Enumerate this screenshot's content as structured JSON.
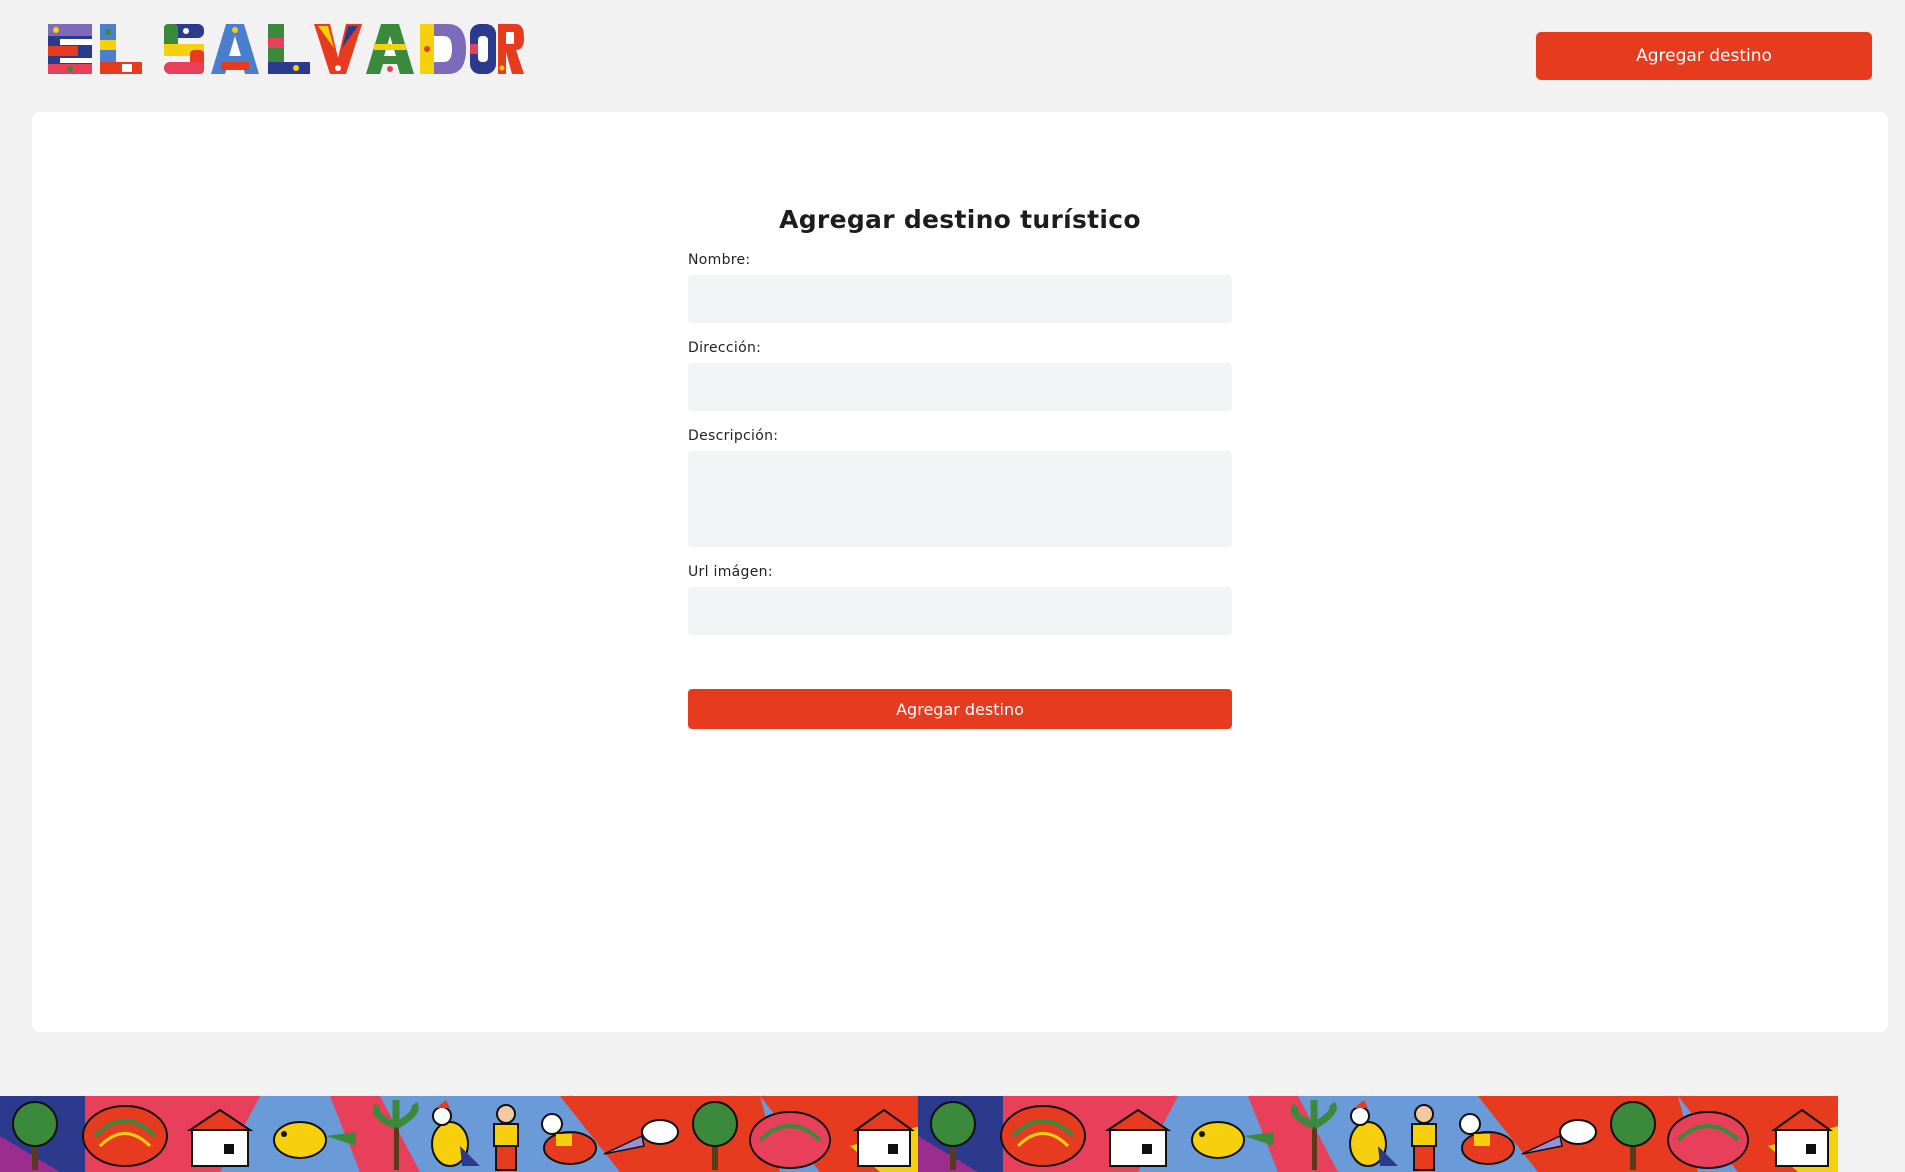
{
  "header": {
    "logo_text": "EL SALVADOR",
    "add_button_label": "Agregar destino"
  },
  "form": {
    "title": "Agregar destino turístico",
    "fields": [
      {
        "label": "Nombre:",
        "value": "",
        "placeholder": ""
      },
      {
        "label": "Dirección:",
        "value": "",
        "placeholder": ""
      },
      {
        "label": "Descripción:",
        "value": "",
        "placeholder": ""
      },
      {
        "label": "Url imágen:",
        "value": "",
        "placeholder": ""
      }
    ],
    "submit_label": "Agregar destino"
  },
  "theme": {
    "accent": "#e63b1f",
    "page_background": "#f2f2f2",
    "card_background": "#ffffff",
    "input_background": "#f2f3f4"
  },
  "footer": {
    "decoration_icons": [
      "tree-icon",
      "armadillo-icon",
      "house-icon",
      "bird-icon",
      "palm-icon",
      "rooster-icon",
      "woman-icon",
      "horse-icon",
      "dove-icon"
    ]
  }
}
